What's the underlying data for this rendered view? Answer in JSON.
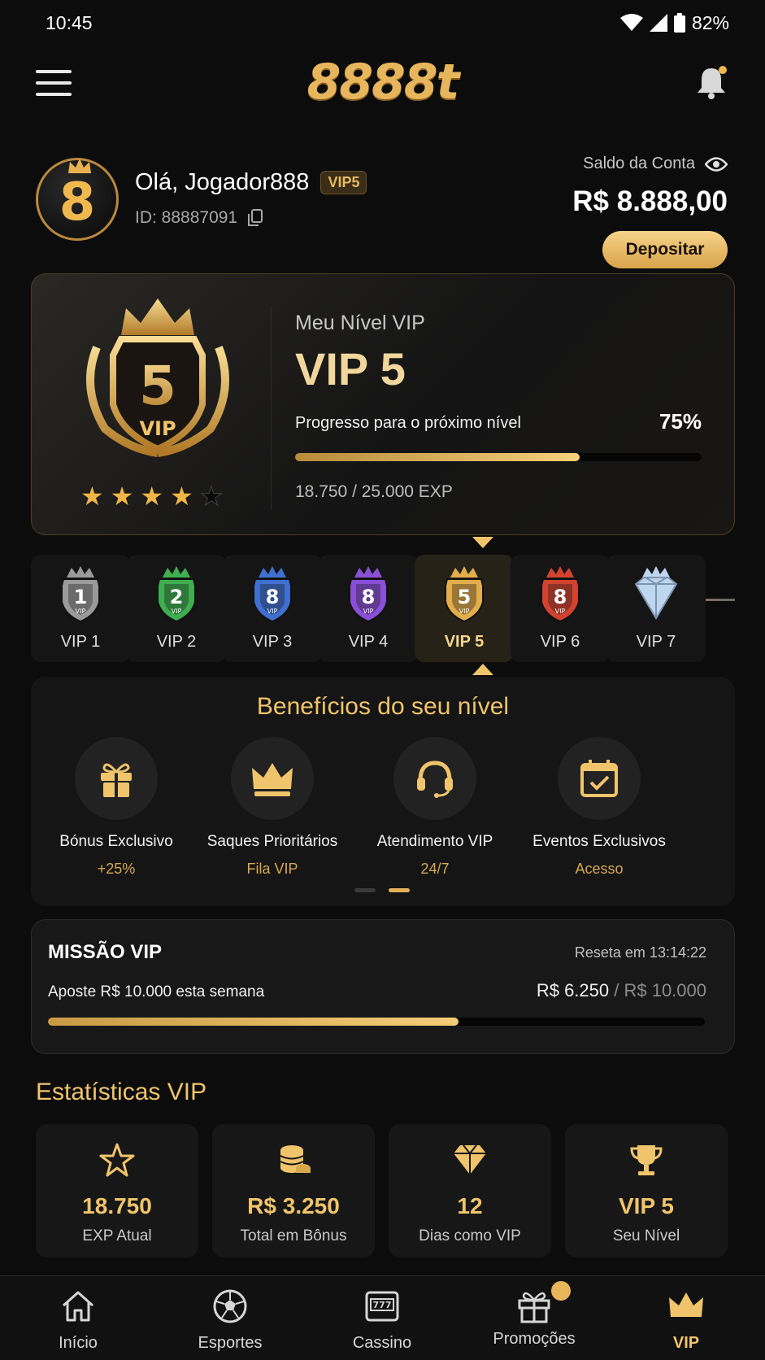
{
  "status_bar": {
    "time": "10:45",
    "battery": "82%"
  },
  "header": {
    "logo": "8888t",
    "menu_icon": "hamburger-menu-icon",
    "bell_icon": "bell-icon"
  },
  "account": {
    "avatar_text": "8",
    "greeting": "Olá, Jogador888",
    "vip_badge": "VIP5",
    "user_id": "ID: 88887091",
    "balance_label": "Saldo da Conta",
    "balance_value": "R$ 8.888,00",
    "deposit_label": "Depositar"
  },
  "vip_card": {
    "shield_number": "5",
    "shield_vip": "VIP",
    "stars_filled": 4,
    "stars_total": 5,
    "label": "Meu Nível VIP",
    "level": "VIP 5",
    "progress_label": "Progresso para o próximo nível",
    "progress_percent_text": "75%",
    "progress_fraction": 0.7,
    "exp_text": "18.750 / 25.000 EXP"
  },
  "levels": [
    {
      "name": "VIP 1",
      "num": "1",
      "color": "#9a9a9a"
    },
    {
      "name": "VIP 2",
      "num": "2",
      "color": "#3fae4f"
    },
    {
      "name": "VIP 3",
      "num": "8",
      "color": "#3f6fd0"
    },
    {
      "name": "VIP 4",
      "num": "8",
      "color": "#8a4fd6"
    },
    {
      "name": "VIP 5",
      "num": "5",
      "color": "#e2ad4a",
      "active": true
    },
    {
      "name": "VIP 6",
      "num": "8",
      "color": "#d2432f"
    },
    {
      "name": "VIP 7",
      "num": "",
      "color": "#bfd6f0"
    }
  ],
  "benefits": {
    "title": "Benefícios do seu nível",
    "items": [
      {
        "name": "Bónus Exclusivo",
        "sub": "+25%",
        "icon": "gift-icon"
      },
      {
        "name": "Saques Prioritários",
        "sub": "Fila VIP",
        "icon": "crown-icon"
      },
      {
        "name": "Atendimento VIP",
        "sub": "24/7",
        "icon": "headset-icon"
      },
      {
        "name": "Eventos Exclusivos",
        "sub": "Acesso",
        "icon": "calendar-check-icon"
      }
    ]
  },
  "mission": {
    "title": "MISSÃO VIP",
    "reset": "Reseta em 13:14:22",
    "desc": "Aposte R$ 10.000 esta semana",
    "current": "R$ 6.250",
    "target": "/ R$ 10.000",
    "progress_fraction": 0.625
  },
  "stats": {
    "title": "Estatísticas VIP",
    "items": [
      {
        "value": "18.750",
        "label": "EXP Atual",
        "icon": "star-icon"
      },
      {
        "value": "R$ 3.250",
        "label": "Total em Bônus",
        "icon": "coins-icon"
      },
      {
        "value": "12",
        "label": "Dias como VIP",
        "icon": "diamond-icon"
      },
      {
        "value": "VIP 5",
        "label": "Seu Nível",
        "icon": "trophy-icon"
      }
    ]
  },
  "nav": [
    {
      "label": "Início",
      "icon": "home-icon"
    },
    {
      "label": "Esportes",
      "icon": "soccer-ball-icon"
    },
    {
      "label": "Cassino",
      "icon": "slot-machine-icon"
    },
    {
      "label": "Promoções",
      "icon": "gift-icon"
    },
    {
      "label": "VIP",
      "icon": "crown-icon",
      "active": true
    }
  ],
  "colors": {
    "gold": "#f0c46a",
    "background": "#0c0c0d",
    "card": "#151515"
  }
}
